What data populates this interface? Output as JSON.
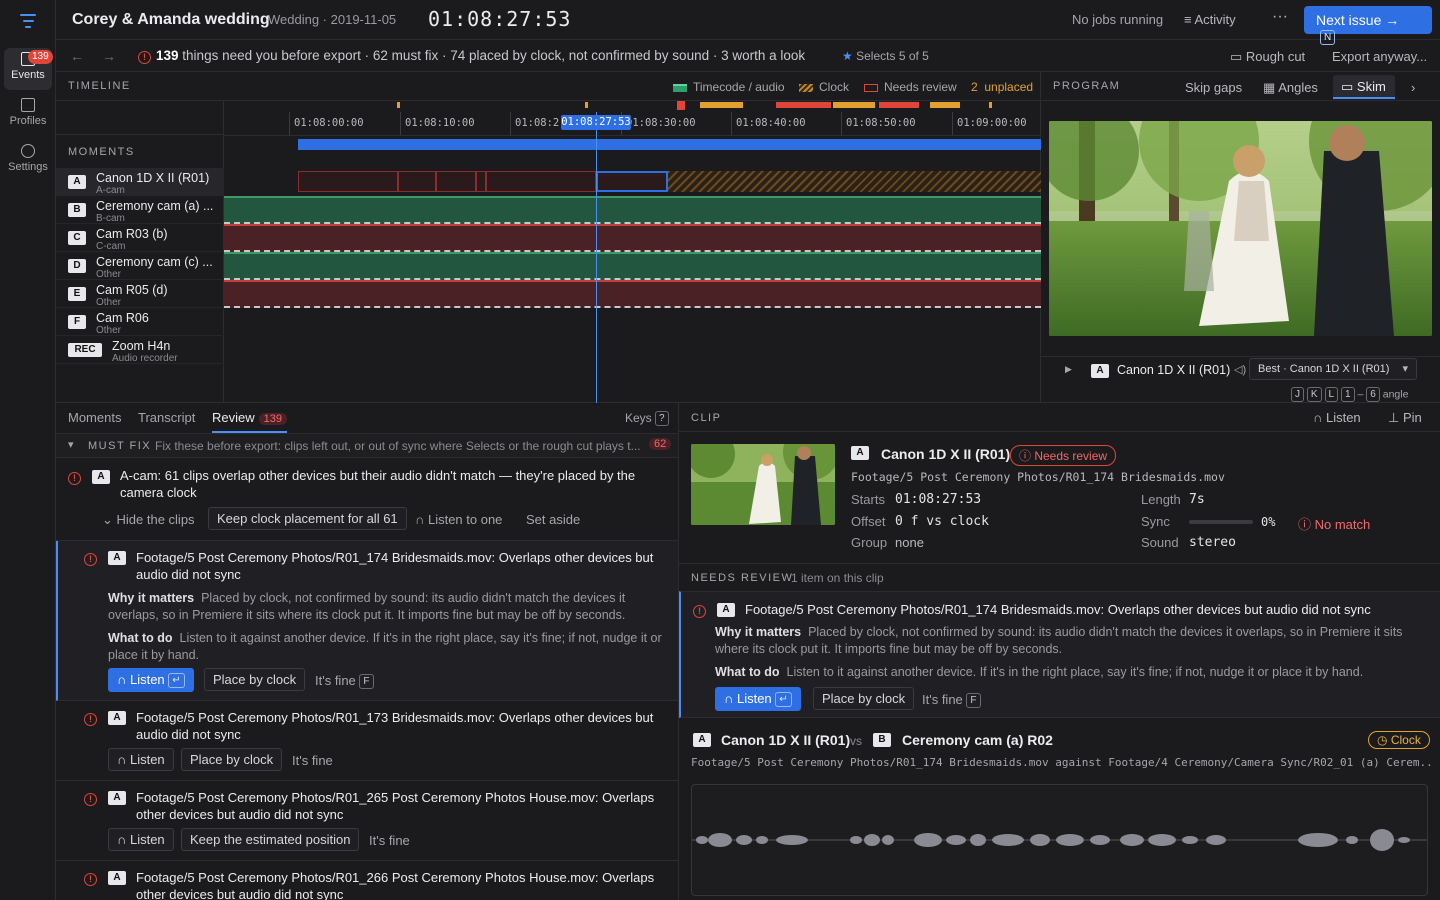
{
  "header": {
    "project_title": "Corey & Amanda wedding",
    "project_sub": "Wedding · 2019-11-05",
    "timecode": "01:08:27:53",
    "jobs": "No jobs running",
    "activity": "Activity",
    "more": "···",
    "next_issue": "Next issue →",
    "next_key": "N"
  },
  "rail": {
    "badge": "139",
    "items": [
      {
        "label": "Events",
        "icon": "events-icon"
      },
      {
        "label": "Profiles",
        "icon": "profiles-icon"
      },
      {
        "label": "Settings",
        "icon": "settings-icon"
      }
    ]
  },
  "issue_bar": {
    "count": "139",
    "text": "things need you before export · 62 must fix · 74 placed by clock, not confirmed by sound · 3 worth a look",
    "selects_label": "Selects",
    "selects_value": "5 of 5",
    "rough_cut": "Rough cut",
    "export": "Export anyway..."
  },
  "timeline": {
    "label": "TIMELINE",
    "legend": {
      "timecode_audio": "Timecode / audio",
      "clock": "Clock",
      "needs_review": "Needs review",
      "unplaced_count": "2",
      "unplaced": "unplaced"
    },
    "ticks": [
      "01:08:00:00",
      "01:08:10:00",
      "01:08:2",
      "01:08:30:00",
      "01:08:40:00",
      "01:08:50:00",
      "01:09:00:00"
    ],
    "playhead": "01:08:27:53",
    "moments_label": "MOMENTS",
    "tracks": [
      {
        "badge": "A",
        "name": "Canon 1D X II (R01)",
        "role": "A-cam"
      },
      {
        "badge": "B",
        "name": "Ceremony cam (a) ...",
        "role": "B-cam"
      },
      {
        "badge": "C",
        "name": "Cam R03 (b)",
        "role": "C-cam"
      },
      {
        "badge": "D",
        "name": "Ceremony cam (c) ...",
        "role": "Other"
      },
      {
        "badge": "E",
        "name": "Cam R05 (d)",
        "role": "Other"
      },
      {
        "badge": "F",
        "name": "Cam R06",
        "role": "Other"
      },
      {
        "badge": "REC",
        "name": "Zoom H4n",
        "role": "Audio recorder"
      }
    ]
  },
  "program": {
    "label": "PROGRAM",
    "skip_gaps": "Skip gaps",
    "angles": "Angles",
    "skim": "Skim",
    "cam_badge": "A",
    "cam_name": "Canon 1D X II (R01)",
    "best_select": "Best · Canon 1D X II (R01)",
    "keys": [
      "J",
      "K",
      "L",
      "1",
      "–",
      "6"
    ],
    "angle_word": "angle"
  },
  "review": {
    "tabs": [
      "Moments",
      "Transcript",
      "Review"
    ],
    "review_count": "139",
    "keys": "Keys",
    "keys_hint": "?",
    "must_fix_title": "MUST FIX",
    "must_fix_desc": "Fix these before export: clips left out, or out of sync where Selects or the rough cut plays t...",
    "must_fix_count": "62",
    "group": {
      "badge": "A",
      "title": "A-cam: 61 clips overlap other devices but their audio didn't match — they're placed by the camera clock",
      "hide": "Hide the clips",
      "keep": "Keep clock placement for all 61",
      "listen_one": "Listen to one",
      "set_aside": "Set aside"
    },
    "active_issue": {
      "badge": "A",
      "title": "Footage/5 Post Ceremony Photos/R01_174 Bridesmaids.mov: Overlaps other devices but audio did not sync",
      "why_label": "Why it matters",
      "why": "Placed by clock, not confirmed by sound: its audio didn't match the devices it overlaps, so in Premiere it sits where its clock put it. It imports fine but may be off by seconds.",
      "what_label": "What to do",
      "what": "Listen to it against another device. If it's in the right place, say it's fine; if not, nudge it or place it by hand.",
      "listen": "Listen",
      "listen_key": "↵",
      "place": "Place by clock",
      "fine": "It's fine",
      "fine_key": "F"
    },
    "issues": [
      {
        "badge": "A",
        "title": "Footage/5 Post Ceremony Photos/R01_173 Bridesmaids.mov: Overlaps other devices but audio did not sync",
        "listen": "Listen",
        "action": "Place by clock",
        "fine": "It's fine"
      },
      {
        "badge": "A",
        "title": "Footage/5 Post Ceremony Photos/R01_265 Post Ceremony Photos House.mov: Overlaps other devices but audio did not sync",
        "listen": "Listen",
        "action": "Keep the estimated position",
        "fine": "It's fine"
      },
      {
        "badge": "A",
        "title": "Footage/5 Post Ceremony Photos/R01_266 Post Ceremony Photos House.mov: Overlaps other devices but audio did not sync",
        "listen": "",
        "action": "",
        "fine": ""
      }
    ]
  },
  "clip": {
    "label": "CLIP",
    "listen": "Listen",
    "pin": "Pin",
    "badge": "A",
    "name": "Canon 1D X II (R01)",
    "status": "Needs review",
    "path": "Footage/5 Post Ceremony Photos/R01_174 Bridesmaids.mov",
    "starts_k": "Starts",
    "starts_v": "01:08:27:53",
    "length_k": "Length",
    "length_v": "7s",
    "offset_k": "Offset",
    "offset_v": "0 f vs clock",
    "sync_k": "Sync",
    "sync_v": "0%",
    "sync_fraction": 0,
    "no_match": "No match",
    "group_k": "Group",
    "group_v": "none",
    "sound_k": "Sound",
    "sound_v": "stereo",
    "needs_review_label": "NEEDS REVIEW",
    "needs_review_count": "1 item on this clip",
    "nr": {
      "badge": "A",
      "title": "Footage/5 Post Ceremony Photos/R01_174 Bridesmaids.mov: Overlaps other devices but audio did not sync",
      "why_label": "Why it matters",
      "why": "Placed by clock, not confirmed by sound: its audio didn't match the devices it overlaps, so in Premiere it sits where its clock put it. It imports fine but may be off by seconds.",
      "what_label": "What to do",
      "what": "Listen to it against another device. If it's in the right place, say it's fine; if not, nudge it or place it by hand.",
      "listen": "Listen",
      "listen_key": "↵",
      "place": "Place by clock",
      "fine": "It's fine",
      "fine_key": "F"
    },
    "compare": {
      "a_badge": "A",
      "a_name": "Canon 1D X II (R01)",
      "vs": "vs",
      "b_badge": "B",
      "b_name": "Ceremony cam (a) R02",
      "tag": "Clock",
      "path": "Footage/5 Post Ceremony Photos/R01_174 Bridesmaids.mov against Footage/4 Ceremony/Camera Sync/R02_01 (a) Cerem..."
    }
  },
  "colors": {
    "accent": "#2f6fe4",
    "red": "#e0453a",
    "green": "#2f9e6a",
    "amber": "#e2a030"
  }
}
